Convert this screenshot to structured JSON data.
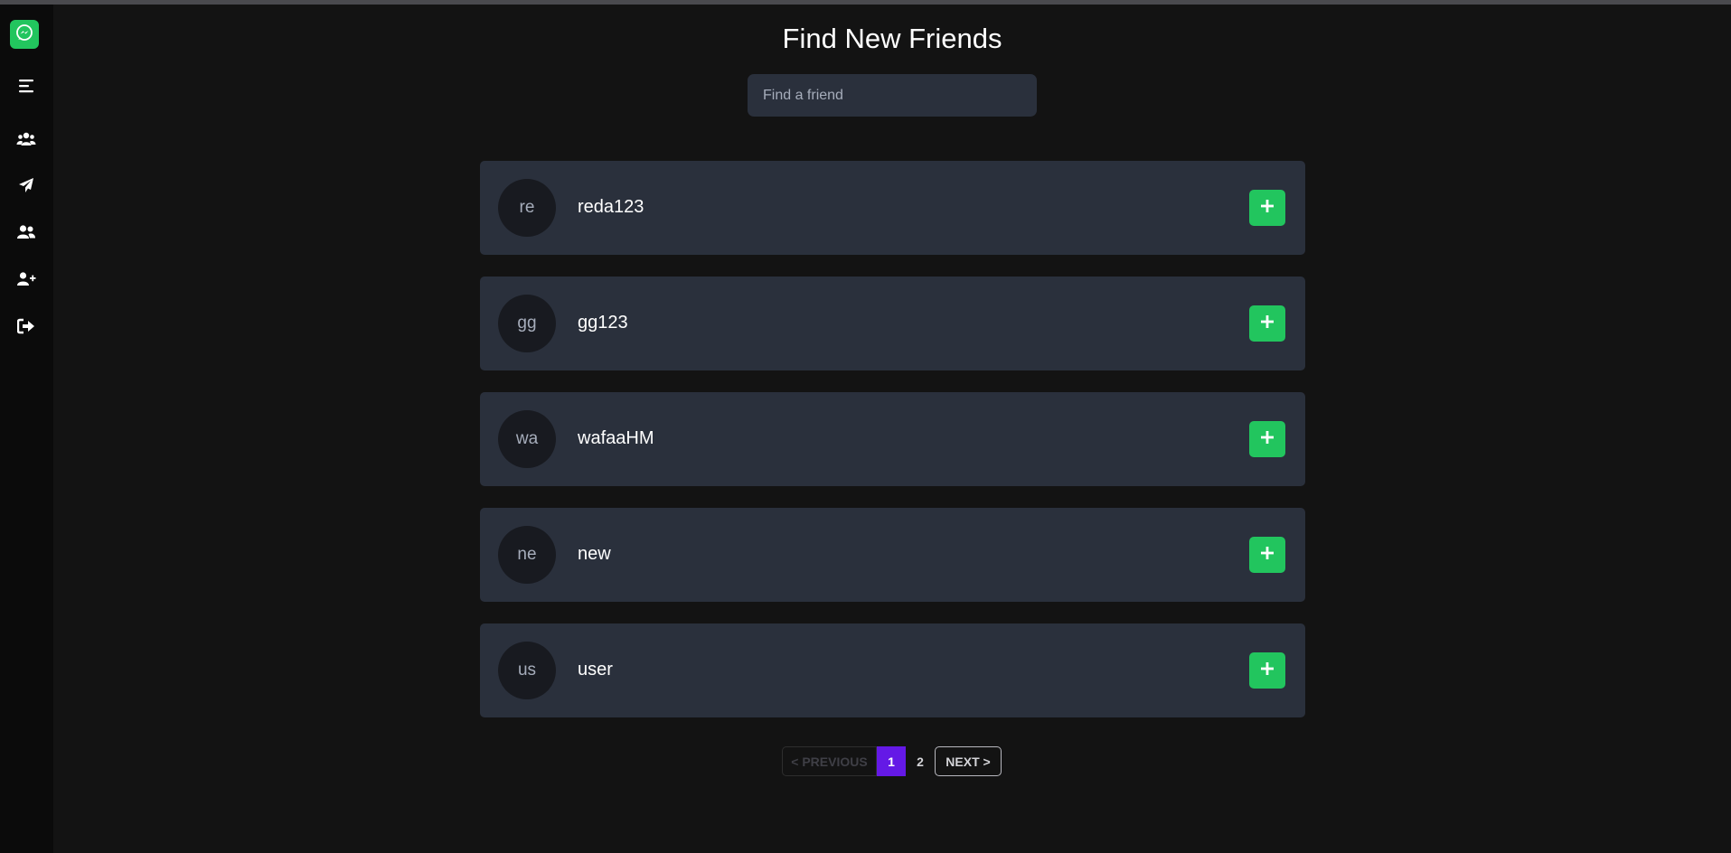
{
  "page": {
    "title": "Find New Friends"
  },
  "search": {
    "placeholder": "Find a friend",
    "value": ""
  },
  "sidebar": {
    "logo_icon": "messenger-icon",
    "items": [
      {
        "icon": "menu-icon"
      },
      {
        "icon": "users-group-icon"
      },
      {
        "icon": "paper-plane-icon"
      },
      {
        "icon": "user-friends-icon"
      },
      {
        "icon": "user-plus-icon"
      },
      {
        "icon": "sign-out-icon"
      }
    ]
  },
  "users": [
    {
      "initials": "re",
      "name": "reda123",
      "action_icon": "plus-icon"
    },
    {
      "initials": "gg",
      "name": "gg123",
      "action_icon": "plus-icon"
    },
    {
      "initials": "wa",
      "name": "wafaaHM",
      "action_icon": "plus-icon"
    },
    {
      "initials": "ne",
      "name": "new",
      "action_icon": "plus-icon"
    },
    {
      "initials": "us",
      "name": "user",
      "action_icon": "plus-icon"
    }
  ],
  "pagination": {
    "previous_label": "< PREVIOUS",
    "pages": [
      "1",
      "2"
    ],
    "current_page": "1",
    "next_label": "NEXT >"
  },
  "colors": {
    "background": "#131313",
    "sidebar": "#0b0b0b",
    "card": "#2a303c",
    "accent_green": "#22c55e",
    "active_page": "#6419e6"
  }
}
